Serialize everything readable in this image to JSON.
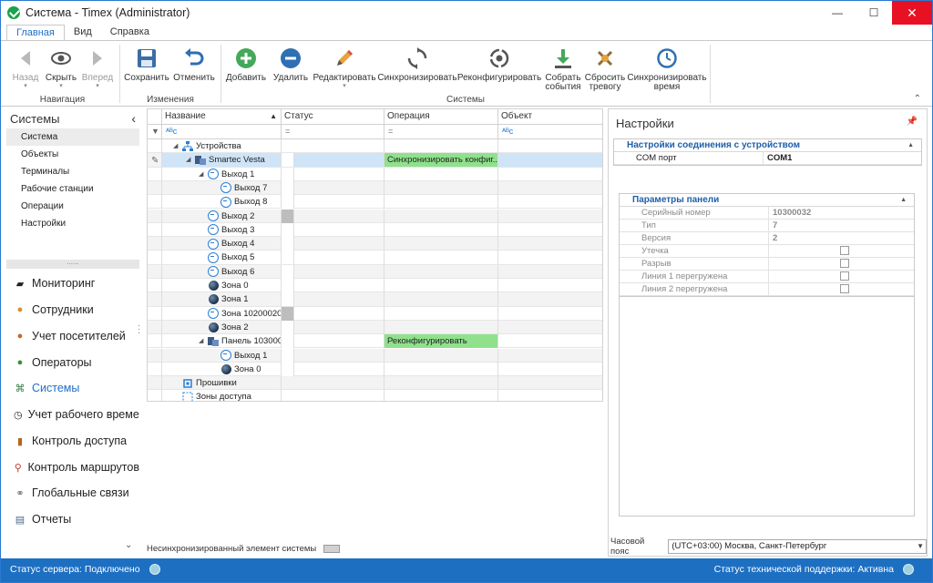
{
  "window": {
    "title": "Система - Timex (Administrator)",
    "minimize": "—",
    "maximize": "☐",
    "close": "✕"
  },
  "ribbon_tabs": [
    "Главная",
    "Вид",
    "Справка"
  ],
  "ribbon": {
    "nav": {
      "back": "Назад",
      "hide": "Скрыть",
      "forward": "Вперед",
      "group": "Навигация"
    },
    "changes": {
      "save": "Сохранить",
      "cancel": "Отменить",
      "group": "Изменения"
    },
    "systems": {
      "add": "Добавить",
      "delete": "Удалить",
      "edit": "Редактировать",
      "sync": "Синхронизировать",
      "reconfig": "Реконфигурировать",
      "collect1": "Собрать",
      "collect2": "события",
      "reset1": "Сбросить",
      "reset2": "тревогу",
      "synctime1": "Синхронизировать",
      "synctime2": "время",
      "group": "Системы"
    }
  },
  "leftnav": {
    "header": "Системы",
    "items": [
      "Система",
      "Объекты",
      "Терминалы",
      "Рабочие станции",
      "Операции",
      "Настройки"
    ],
    "modules": [
      "Мониторинг",
      "Сотрудники",
      "Учет посетителей",
      "Операторы",
      "Системы",
      "Учет рабочего времени",
      "Контроль доступа",
      "Контроль маршрутов",
      "Глобальные связи",
      "Отчеты"
    ]
  },
  "grid": {
    "columns": [
      "Название",
      "Статус",
      "Операция",
      "Объект"
    ],
    "rows": [
      {
        "name": "Устройства",
        "op": ""
      },
      {
        "name": "Smartec Vesta",
        "op": "Синхронизировать конфиг..."
      },
      {
        "name": "Выход 1",
        "op": ""
      },
      {
        "name": "Выход 7",
        "op": ""
      },
      {
        "name": "Выход 8",
        "op": ""
      },
      {
        "name": "Выход 2",
        "op": ""
      },
      {
        "name": "Выход 3",
        "op": ""
      },
      {
        "name": "Выход 4",
        "op": ""
      },
      {
        "name": "Выход 5",
        "op": ""
      },
      {
        "name": "Выход 6",
        "op": ""
      },
      {
        "name": "Зона 0",
        "op": ""
      },
      {
        "name": "Зона 1",
        "op": ""
      },
      {
        "name": "Зона 10200020",
        "op": ""
      },
      {
        "name": "Зона 2",
        "op": ""
      },
      {
        "name": "Панель 103000...",
        "op": "Реконфигурировать"
      },
      {
        "name": "Выход 1",
        "op": ""
      },
      {
        "name": "Зона 0",
        "op": ""
      },
      {
        "name": "Прошивки",
        "op": ""
      },
      {
        "name": "Зоны доступа",
        "op": ""
      }
    ]
  },
  "legend": "Несинхронизированный элемент системы",
  "settings": {
    "title": "Настройки",
    "conn_title": "Настройки соединения с устройством",
    "com_label": "COM порт",
    "com_value": "COM1",
    "panel_title": "Параметры панели",
    "serial_label": "Серийный номер",
    "serial_value": "10300032",
    "type_label": "Тип",
    "type_value": "7",
    "version_label": "Версия",
    "version_value": "2",
    "leak_label": "Утечка",
    "break_label": "Разрыв",
    "line1_label": "Линия 1 перегружена",
    "line2_label": "Линия 2 перегружена",
    "tz_label": "Часовой пояс",
    "tz_value": "(UTC+03:00) Москва, Санкт-Петербург"
  },
  "status": {
    "server": "Статус сервера: Подключено",
    "support": "Статус технической поддержки: Активна"
  },
  "colors": {
    "accent": "#1d6fc2",
    "sync_highlight": "#8fe18c"
  }
}
